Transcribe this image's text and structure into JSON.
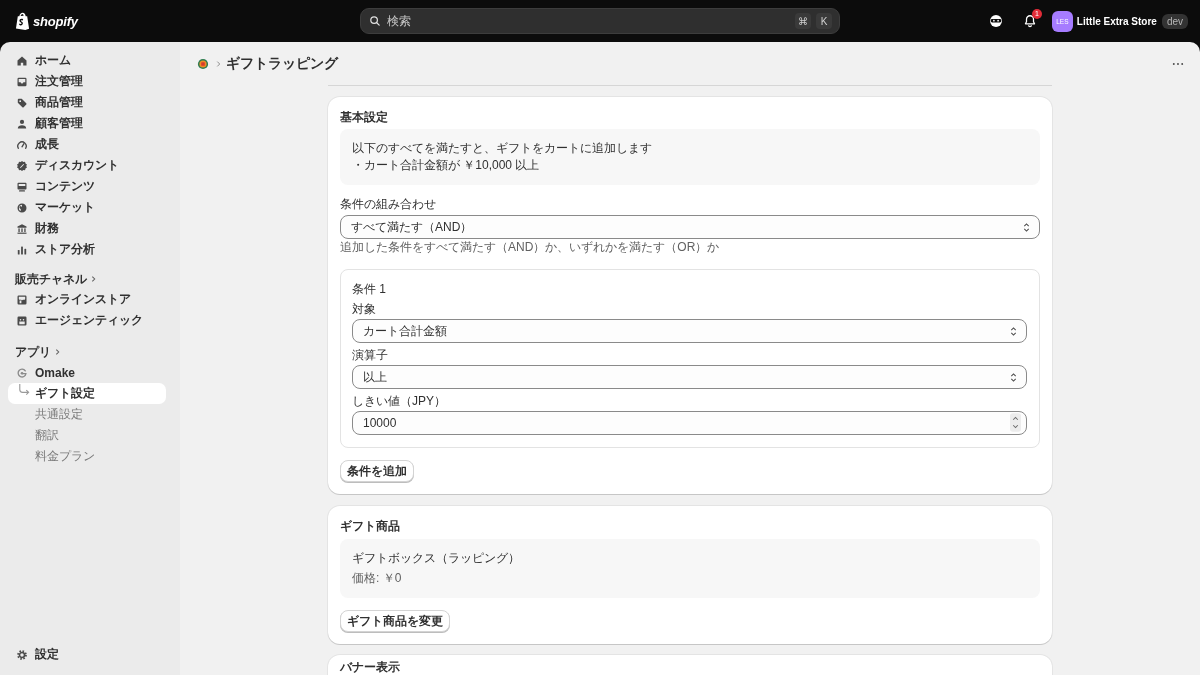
{
  "top_bar": {
    "logo": "shopify",
    "search": {
      "placeholder": "検索",
      "shortcut": [
        "⌘",
        "K"
      ]
    },
    "notifications": {
      "count": "1"
    },
    "store": {
      "initials": "LES",
      "name": "Little Extra Store",
      "environment": "dev"
    }
  },
  "sidebar": {
    "items": [
      {
        "label": "ホーム",
        "selected": false
      },
      {
        "label": "注文管理",
        "selected": false
      },
      {
        "label": "商品管理",
        "selected": false
      },
      {
        "label": "顧客管理",
        "selected": false
      },
      {
        "label": "成長",
        "selected": false
      },
      {
        "label": "ディスカウント",
        "selected": false
      },
      {
        "label": "コンテンツ",
        "selected": false
      },
      {
        "label": "マーケット",
        "selected": false
      },
      {
        "label": "財務",
        "selected": false
      },
      {
        "label": "ストア分析",
        "selected": false
      }
    ],
    "sales_channels": {
      "heading": "販売チャネル",
      "items": [
        {
          "label": "オンラインストア",
          "selected": false
        },
        {
          "label": "エージェンティック",
          "selected": false
        }
      ]
    },
    "apps": {
      "heading": "アプリ",
      "items": [
        {
          "label": "Omake",
          "selected": false,
          "children": [
            {
              "label": "ギフト設定",
              "selected": true
            },
            {
              "label": "共通設定",
              "selected": false
            },
            {
              "label": "翻訳",
              "selected": false
            },
            {
              "label": "料金プラン",
              "selected": false
            }
          ]
        }
      ]
    },
    "settings": {
      "label": "設定",
      "selected": false
    }
  },
  "page": {
    "title": "ギフトラッピング"
  },
  "basic_settings": {
    "title": "基本設定",
    "summary": [
      "以下のすべてを満たすと、ギフトをカートに追加します",
      "・カート合計金額が ￥10,000 以上"
    ],
    "combination": {
      "label": "条件の組み合わせ",
      "value": "すべて満たす（AND）",
      "help": "追加した条件をすべて満たす（AND）か、いずれかを満たす（OR）か"
    },
    "conditions": [
      {
        "title": "条件 1",
        "fields": [
          {
            "kind": "select",
            "label": "対象",
            "value": "カート合計金額"
          },
          {
            "kind": "select",
            "label": "演算子",
            "value": "以上"
          },
          {
            "kind": "number",
            "label": "しきい値（JPY）",
            "value": "10000"
          }
        ]
      }
    ],
    "add_button": "条件を追加"
  },
  "gift_product": {
    "title": "ギフト商品",
    "product_name": "ギフトボックス（ラッピング）",
    "price": "価格: ￥0",
    "change_button": "ギフト商品を変更"
  },
  "banner": {
    "title": "バナー表示"
  }
}
